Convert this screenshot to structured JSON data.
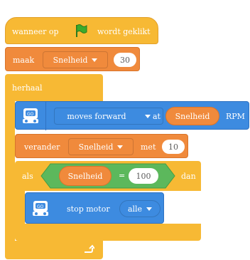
{
  "blocks": {
    "when_flag": {
      "label_before": "wanneer op",
      "label_after": "wordt geklikt",
      "icon": "green-flag-icon"
    },
    "set_var": {
      "label": "maak",
      "variable": "Snelheid",
      "value": "30"
    },
    "forever": {
      "label": "herhaal",
      "loop_icon": "loop-arrow-icon"
    },
    "move_forward": {
      "direction": "moves forward",
      "at_label": "at",
      "variable": "Snelheid",
      "unit": "RPM"
    },
    "change_var": {
      "label": "verander",
      "variable": "Snelheid",
      "by_label": "met",
      "value": "10"
    },
    "if_block": {
      "label": "als",
      "then_label": "dan"
    },
    "equals": {
      "variable": "Snelheid",
      "operator": "=",
      "value": "100"
    },
    "stop_motor": {
      "label": "stop motor",
      "option": "alle"
    }
  },
  "colors": {
    "control": "#f7b934",
    "variable": "#f08a3c",
    "extension": "#3d8be0",
    "operator": "#5cb85c",
    "flag": "#3cab2b"
  }
}
